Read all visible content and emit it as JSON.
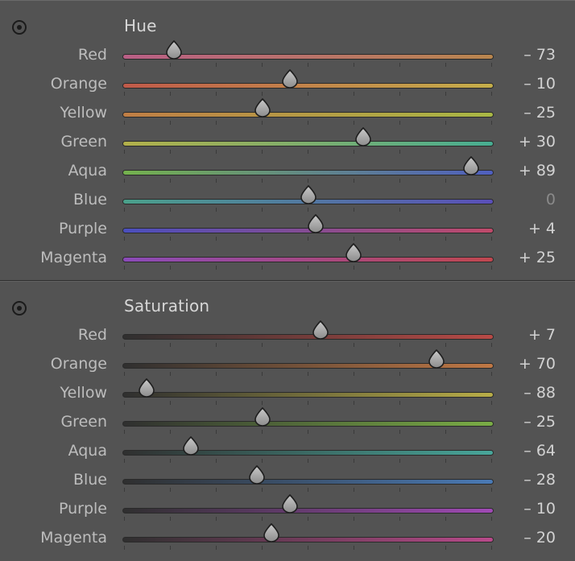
{
  "hue": {
    "title": "Hue",
    "rows": [
      {
        "label": "Red",
        "value": "– 73",
        "num": -73,
        "c1": "#b95f86",
        "c2": "#b9864e"
      },
      {
        "label": "Orange",
        "value": "– 10",
        "num": -10,
        "c1": "#c05a4a",
        "c2": "#c4ae4a"
      },
      {
        "label": "Yellow",
        "value": "– 25",
        "num": -25,
        "c1": "#c07e45",
        "c2": "#a9b845"
      },
      {
        "label": "Green",
        "value": "+ 30",
        "num": 30,
        "c1": "#b3b04a",
        "c2": "#47ad92"
      },
      {
        "label": "Aqua",
        "value": "+ 89",
        "num": 89,
        "c1": "#74b14d",
        "c2": "#4f5fc0"
      },
      {
        "label": "Blue",
        "value": "0",
        "num": 0,
        "c1": "#4aa08a",
        "c2": "#5a4fb8"
      },
      {
        "label": "Purple",
        "value": "+ 4",
        "num": 4,
        "c1": "#4a4fbd",
        "c2": "#c04a6a"
      },
      {
        "label": "Magenta",
        "value": "+ 25",
        "num": 25,
        "c1": "#8a4ab8",
        "c2": "#c0474f"
      }
    ]
  },
  "saturation": {
    "title": "Saturation",
    "rows": [
      {
        "label": "Red",
        "value": "+ 7",
        "num": 7,
        "c1": "#2f2f2f",
        "c2": "#b84a46"
      },
      {
        "label": "Orange",
        "value": "+ 70",
        "num": 70,
        "c1": "#2f2f2f",
        "c2": "#c07845"
      },
      {
        "label": "Yellow",
        "value": "– 88",
        "num": -88,
        "c1": "#2f2f2f",
        "c2": "#b8ad48"
      },
      {
        "label": "Green",
        "value": "– 25",
        "num": -25,
        "c1": "#2f2f2f",
        "c2": "#7aad46"
      },
      {
        "label": "Aqua",
        "value": "– 64",
        "num": -64,
        "c1": "#2f2f2f",
        "c2": "#48a69a"
      },
      {
        "label": "Blue",
        "value": "– 28",
        "num": -28,
        "c1": "#2f2f2f",
        "c2": "#4a7ab5"
      },
      {
        "label": "Purple",
        "value": "– 10",
        "num": -10,
        "c1": "#2f2f2f",
        "c2": "#a04ab5"
      },
      {
        "label": "Magenta",
        "value": "– 20",
        "num": -20,
        "c1": "#2f2f2f",
        "c2": "#b84a8a"
      }
    ]
  }
}
